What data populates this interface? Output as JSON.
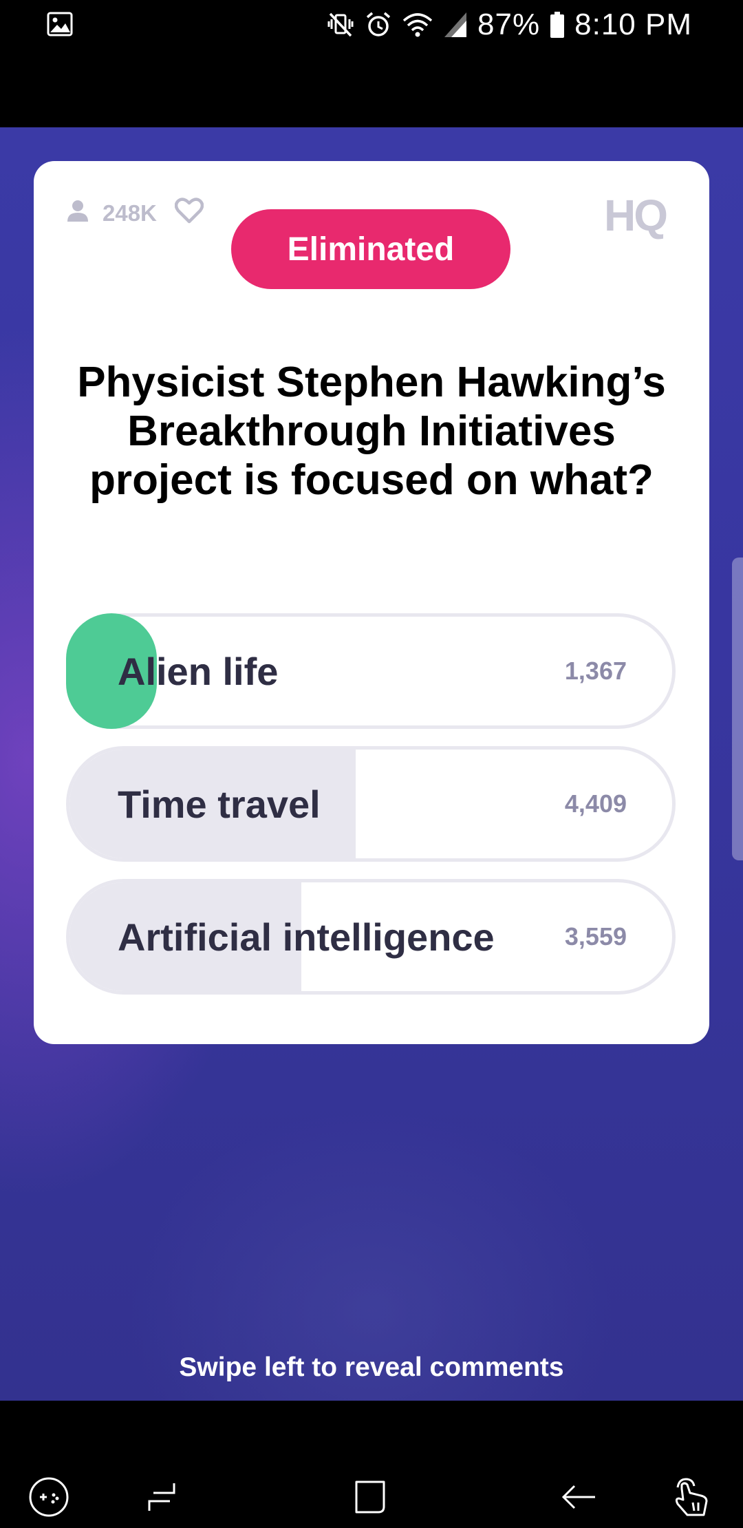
{
  "status_bar": {
    "battery_pct": "87%",
    "time": "8:10 PM",
    "icons": [
      "gallery-icon",
      "mute-vibrate-icon",
      "alarm-icon",
      "wifi-icon",
      "signal-icon",
      "battery-icon"
    ]
  },
  "card": {
    "viewers": "248K",
    "logo": "HQ",
    "status_badge": "Eliminated",
    "question": "Physicist Stephen Hawking’s Breakthrough Initiatives project is focused on what?",
    "answers": [
      {
        "label": "Alien life",
        "count": "1,367",
        "correct": true,
        "fill_fraction": 0.21
      },
      {
        "label": "Time travel",
        "count": "4,409",
        "correct": false,
        "fill_fraction": 0.475
      },
      {
        "label": "Artificial intelligence",
        "count": "3,559",
        "correct": false,
        "fill_fraction": 0.385
      }
    ]
  },
  "hint": "Swipe left to reveal comments",
  "colors": {
    "eliminated": "#e8296e",
    "correct": "#4ecb95",
    "background": "#3836a0"
  },
  "nav_bar": {
    "icons": [
      "game-tools-icon",
      "recent-apps-icon",
      "home-icon",
      "back-icon",
      "assist-touch-icon"
    ]
  }
}
